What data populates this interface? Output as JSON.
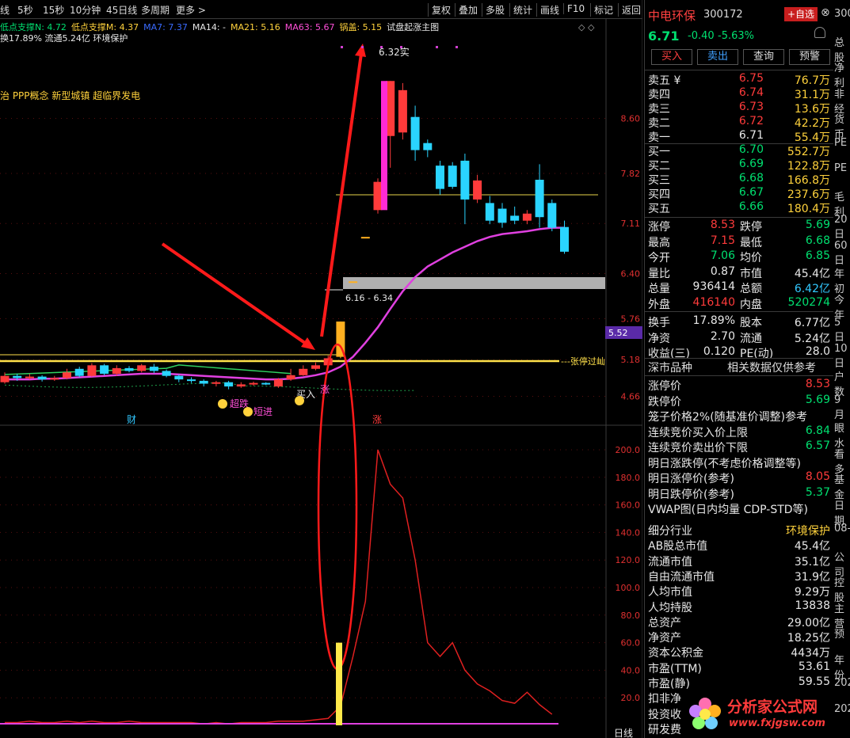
{
  "toolbar": {
    "left_items": [
      "线",
      "5秒",
      "15秒",
      "10分钟",
      "45日线",
      "多周期",
      "更多 >"
    ],
    "right_items": [
      "复权",
      "叠加",
      "多股",
      "统计",
      "画线",
      "F10",
      "标记",
      "返回"
    ]
  },
  "indicators": {
    "line1": [
      "低点支撑N: 4.72",
      "低点支撑M: 4.37",
      "MA7: 7.37",
      "MA14: -",
      "MA21: 5.16",
      "MA63: 5.67",
      "锅盖: 5.15",
      "试盘起涨主图"
    ],
    "line2": "换17.89% 流通5.24亿 环境保护",
    "concepts": "治 PPP概念 新型城镇 超临界发电",
    "end_marker": "◇ ◇"
  },
  "chart_labels": {
    "top_mark": "6.32实",
    "box_label": "6.16 - 6.34",
    "limit_line_label": "张停过屾",
    "current_price_tag": "5.52",
    "mark_cai": "财",
    "mark_zhang": "涨",
    "mark_buy": "买入",
    "mark_zhang2": "涨",
    "tag_chao": "超跌",
    "tag_duan": "短进",
    "bottom_tag": "日线"
  },
  "price_axis": [
    "8.60",
    "7.82",
    "7.11",
    "6.40",
    "5.76",
    "5.18",
    "4.66"
  ],
  "vol_axis": [
    "200.0",
    "180.0",
    "160.0",
    "140.0",
    "120.0",
    "100.0",
    "80.0",
    "60.0",
    "40.0",
    "20.0"
  ],
  "chart_data": {
    "type": "candlestick",
    "candles": [
      {
        "o": 4.86,
        "c": 4.95,
        "h": 5.0,
        "l": 4.84
      },
      {
        "o": 4.95,
        "c": 4.92,
        "h": 4.98,
        "l": 4.88
      },
      {
        "o": 4.92,
        "c": 4.94,
        "h": 4.98,
        "l": 4.9
      },
      {
        "o": 4.94,
        "c": 4.9,
        "h": 4.96,
        "l": 4.87
      },
      {
        "o": 4.9,
        "c": 4.92,
        "h": 4.95,
        "l": 4.88
      },
      {
        "o": 4.92,
        "c": 5.0,
        "h": 5.05,
        "l": 4.9
      },
      {
        "o": 5.05,
        "c": 4.95,
        "h": 5.08,
        "l": 4.93
      },
      {
        "o": 4.95,
        "c": 5.1,
        "h": 5.13,
        "l": 4.94
      },
      {
        "o": 5.1,
        "c": 4.98,
        "h": 5.12,
        "l": 4.96
      },
      {
        "o": 4.98,
        "c": 5.06,
        "h": 5.1,
        "l": 4.95
      },
      {
        "o": 5.06,
        "c": 5.02,
        "h": 5.09,
        "l": 5.0
      },
      {
        "o": 5.02,
        "c": 5.1,
        "h": 5.12,
        "l": 5.0
      },
      {
        "o": 5.08,
        "c": 5.02,
        "h": 5.12,
        "l": 4.99
      },
      {
        "o": 5.02,
        "c": 4.95,
        "h": 5.04,
        "l": 4.93
      },
      {
        "o": 4.95,
        "c": 4.9,
        "h": 4.97,
        "l": 4.86
      },
      {
        "o": 4.9,
        "c": 4.88,
        "h": 4.93,
        "l": 4.85
      },
      {
        "o": 4.88,
        "c": 4.84,
        "h": 4.9,
        "l": 4.8
      },
      {
        "o": 4.84,
        "c": 4.86,
        "h": 4.88,
        "l": 4.8
      },
      {
        "o": 4.86,
        "c": 4.8,
        "h": 4.88,
        "l": 4.76
      },
      {
        "o": 4.8,
        "c": 4.83,
        "h": 4.86,
        "l": 4.78
      },
      {
        "o": 4.83,
        "c": 4.85,
        "h": 4.87,
        "l": 4.81
      },
      {
        "o": 4.85,
        "c": 4.84,
        "h": 4.86,
        "l": 4.82
      },
      {
        "o": 4.8,
        "c": 4.9,
        "h": 4.92,
        "l": 4.78
      },
      {
        "o": 4.9,
        "c": 4.96,
        "h": 5.05,
        "l": 4.88
      },
      {
        "o": 4.96,
        "c": 5.05,
        "h": 5.1,
        "l": 4.95
      },
      {
        "o": 5.05,
        "c": 5.1,
        "h": 5.14,
        "l": 5.03
      },
      {
        "o": 5.1,
        "c": 5.2,
        "h": 5.24,
        "l": 5.08
      },
      {
        "o": 5.22,
        "c": 5.72,
        "h": 5.72,
        "l": 5.2
      },
      {
        "o": 6.29,
        "c": 6.29,
        "h": 6.29,
        "l": 6.29
      },
      {
        "o": 6.92,
        "c": 6.92,
        "h": 6.92,
        "l": 6.92
      },
      {
        "o": 7.3,
        "c": 7.7,
        "h": 7.75,
        "l": 7.25
      },
      {
        "o": 8.35,
        "c": 9.13,
        "h": 9.13,
        "l": 7.9
      },
      {
        "o": 8.4,
        "c": 9.0,
        "h": 9.1,
        "l": 8.3
      },
      {
        "o": 8.62,
        "c": 8.15,
        "h": 8.78,
        "l": 8.0
      },
      {
        "o": 8.25,
        "c": 8.15,
        "h": 8.3,
        "l": 8.05
      },
      {
        "o": 7.93,
        "c": 7.6,
        "h": 8.0,
        "l": 7.52
      },
      {
        "o": 7.93,
        "c": 7.63,
        "h": 7.98,
        "l": 7.6
      },
      {
        "o": 8.0,
        "c": 7.45,
        "h": 8.1,
        "l": 7.1
      },
      {
        "o": 7.45,
        "c": 7.72,
        "h": 7.8,
        "l": 7.4
      },
      {
        "o": 7.4,
        "c": 7.15,
        "h": 7.5,
        "l": 7.1
      },
      {
        "o": 7.32,
        "c": 7.12,
        "h": 7.4,
        "l": 7.05
      },
      {
        "o": 7.22,
        "c": 7.15,
        "h": 7.35,
        "l": 7.1
      },
      {
        "o": 7.15,
        "c": 7.25,
        "h": 7.3,
        "l": 7.1
      },
      {
        "o": 7.73,
        "c": 7.2,
        "h": 7.95,
        "l": 7.05
      },
      {
        "o": 7.4,
        "c": 7.05,
        "h": 7.45,
        "l": 7.0
      },
      {
        "o": 7.06,
        "c": 6.71,
        "h": 7.15,
        "l": 6.68
      }
    ],
    "ma": [
      4.9,
      4.9,
      4.9,
      4.91,
      4.91,
      4.92,
      4.93,
      4.94,
      4.95,
      4.96,
      4.97,
      4.98,
      4.98,
      4.98,
      4.97,
      4.96,
      4.95,
      4.94,
      4.93,
      4.92,
      4.91,
      4.9,
      4.9,
      4.91,
      4.93,
      4.96,
      5.0,
      5.08,
      5.22,
      5.42,
      5.64,
      5.9,
      6.15,
      6.35,
      6.5,
      6.6,
      6.7,
      6.78,
      6.86,
      6.92,
      6.96,
      6.98,
      7.0,
      7.03,
      7.05,
      7.05
    ],
    "volume": [
      2,
      2,
      3,
      2,
      2,
      3,
      2,
      3,
      2,
      2,
      3,
      2,
      2,
      2,
      2,
      2,
      1,
      2,
      1,
      2,
      2,
      2,
      3,
      3,
      3,
      4,
      5,
      14,
      50,
      90,
      200,
      175,
      165,
      120,
      60,
      50,
      60,
      40,
      30,
      25,
      18,
      16,
      24,
      15,
      8
    ]
  },
  "stock": {
    "name": "中电环保",
    "code": "300172",
    "price": "6.71",
    "change": "-0.40",
    "pct": "-5.63%",
    "add_label": "+自选",
    "close": "⊗"
  },
  "actions": [
    "买入",
    "卖出",
    "查询",
    "预警"
  ],
  "orderbook": {
    "sell": [
      [
        "卖五 ¥",
        "6.75",
        "76.7万"
      ],
      [
        "卖四",
        "6.74",
        "31.1万"
      ],
      [
        "卖三",
        "6.73",
        "13.6万"
      ],
      [
        "卖二",
        "6.72",
        "42.2万"
      ],
      [
        "卖一",
        "6.71",
        "55.4万"
      ]
    ],
    "buy": [
      [
        "买一",
        "6.70",
        "552.7万"
      ],
      [
        "买二",
        "6.69",
        "122.8万"
      ],
      [
        "买三",
        "6.68",
        "166.8万"
      ],
      [
        "买四",
        "6.67",
        "237.6万"
      ],
      [
        "买五",
        "6.66",
        "180.4万"
      ]
    ]
  },
  "stats": [
    [
      [
        "涨停",
        "8.53",
        "up"
      ],
      [
        "跌停",
        "5.69",
        "dn"
      ]
    ],
    [
      [
        "最高",
        "7.15",
        "up"
      ],
      [
        "最低",
        "6.68",
        "dn"
      ]
    ],
    [
      [
        "今开",
        "7.06",
        "dn"
      ],
      [
        "均价",
        "6.85",
        "dn"
      ]
    ],
    [
      [
        "量比",
        "0.87",
        "wh"
      ],
      [
        "市值",
        "45.4亿",
        "wh"
      ]
    ],
    [
      [
        "总量",
        "936414",
        "wh"
      ],
      [
        "总额",
        "6.42亿",
        "cy"
      ]
    ],
    [
      [
        "外盘",
        "416140",
        "up"
      ],
      [
        "内盘",
        "520274",
        "dn"
      ]
    ],
    [
      [
        "换手",
        "17.89%",
        "wh"
      ],
      [
        "股本",
        "6.77亿",
        "wh"
      ]
    ],
    [
      [
        "净资",
        "2.70",
        "wh"
      ],
      [
        "流通",
        "5.24亿",
        "wh"
      ]
    ],
    [
      [
        "收益(三)",
        "0.120",
        "wh"
      ],
      [
        "PE(动)",
        "28.0",
        "wh"
      ]
    ]
  ],
  "market": {
    "left": "深市品种",
    "right": "相关数据仅供参考"
  },
  "limits": [
    [
      "涨停价",
      "8.53",
      "up"
    ],
    [
      "跌停价",
      "5.69",
      "dn"
    ],
    [
      "笼子价格2%(随基准价调整)参考",
      "",
      "wh"
    ],
    [
      "连续竞价买入价上限",
      "6.84",
      "dn"
    ],
    [
      "连续竞价卖出价下限",
      "6.57",
      "dn"
    ],
    [
      "明日涨跌停(不考虑价格调整等)",
      "",
      "wh"
    ],
    [
      "明日涨停价(参考)",
      "8.05",
      "up"
    ],
    [
      "明日跌停价(参考)",
      "5.37",
      "dn"
    ],
    [
      "VWAP图(日内均量 CDP-STD等)",
      "",
      "wh"
    ]
  ],
  "fundamentals": [
    [
      "细分行业",
      "环境保护",
      "ye"
    ],
    [
      "AB股总市值",
      "45.4亿",
      "wh"
    ],
    [
      "流通市值",
      "35.1亿",
      "wh"
    ],
    [
      "自由流通市值",
      "31.9亿",
      "wh"
    ],
    [
      "人均市值",
      "9.29万",
      "wh"
    ],
    [
      "人均持股",
      "13838",
      "wh"
    ],
    [
      "总资产",
      "29.00亿",
      "wh"
    ],
    [
      "净资产",
      "18.25亿",
      "wh"
    ],
    [
      "资本公积金",
      "4434万",
      "wh"
    ],
    [
      "市盈(TTM)",
      "53.61",
      "wh"
    ],
    [
      "市盈(静)",
      "59.55",
      "wh"
    ],
    [
      "扣非净",
      "",
      "wh"
    ],
    [
      "投资收",
      "",
      "wh"
    ],
    [
      "研发费",
      "",
      "wh"
    ]
  ],
  "edge_labels": [
    "300",
    "总股",
    "净利",
    "非经",
    "货币",
    "PE",
    "PE",
    "毛利",
    "20日",
    "60日",
    "年初",
    "今年",
    "5日",
    "10日",
    "户数",
    "9月",
    "眼水",
    "看多",
    "基金",
    "日期",
    "08-",
    "公司",
    "控股",
    "主营",
    "预",
    "年份",
    "202",
    "202"
  ],
  "watermark": {
    "text": "分析家公式网",
    "url": "www.fxjgsw.com"
  }
}
